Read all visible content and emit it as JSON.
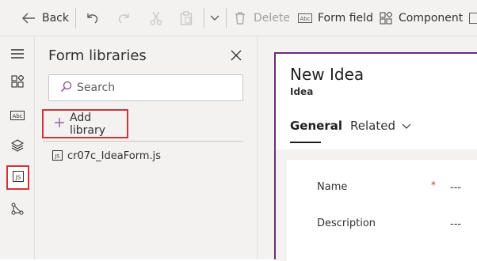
{
  "toolbar": {
    "back_label": "Back",
    "delete_label": "Delete",
    "form_field_label": "Form field",
    "component_label": "Component"
  },
  "rail": {
    "items": [
      {
        "icon": "hamburger-icon"
      },
      {
        "icon": "components-icon"
      },
      {
        "icon": "text-field-icon",
        "text": "Abc"
      },
      {
        "icon": "layers-icon"
      },
      {
        "icon": "js-library-icon",
        "text": "JS",
        "selected": true
      },
      {
        "icon": "tree-view-icon"
      }
    ]
  },
  "panel": {
    "title": "Form libraries",
    "search_placeholder": "Search",
    "add_library_label": "Add library",
    "libraries": [
      {
        "name": "cr07c_IdeaForm.js",
        "icon_text": "JS"
      }
    ]
  },
  "form": {
    "title": "New Idea",
    "entity": "Idea",
    "tabs": [
      {
        "label": "General",
        "active": true
      },
      {
        "label": "Related",
        "active": false
      }
    ],
    "fields": [
      {
        "label": "Name",
        "required_marker": "*",
        "value": "---"
      },
      {
        "label": "Description",
        "value": "---"
      }
    ]
  },
  "colors": {
    "accent_purple": "#6b2d7a",
    "highlight_red": "#d13438",
    "panel_bg": "#f3f2f1"
  }
}
